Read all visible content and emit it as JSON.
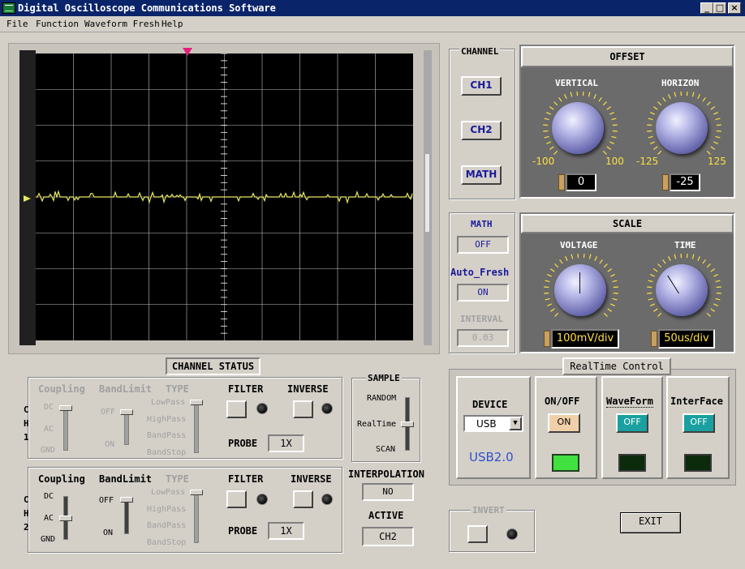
{
  "window": {
    "title": "Digital Oscilloscope Communications Software",
    "controls": [
      "_",
      "□",
      "×"
    ]
  },
  "menu": [
    "File",
    "Function",
    "Waveform Fresh",
    "Help"
  ],
  "channel": {
    "title": "CHANNEL",
    "buttons": [
      "CH1",
      "CH2",
      "MATH"
    ]
  },
  "offset": {
    "title": "OFFSET",
    "vertical": {
      "label": "VERTICAL",
      "min": "-100",
      "max": "100",
      "value": "0"
    },
    "horizon": {
      "label": "HORIZON",
      "min": "-125",
      "max": "125",
      "value": "-25"
    }
  },
  "math_panel": {
    "math_label": "MATH",
    "math_value": "OFF",
    "fresh_label": "Auto_Fresh",
    "fresh_value": "ON",
    "interval_label": "INTERVAL",
    "interval_value": "0.03"
  },
  "scale": {
    "title": "SCALE",
    "voltage": {
      "label": "VOLTAGE",
      "value": "100mV/div"
    },
    "time": {
      "label": "TIME",
      "value": "50us/div"
    }
  },
  "channel_status": {
    "title": "CHANNEL STATUS"
  },
  "ch1": {
    "side": [
      "C",
      "H",
      "1"
    ],
    "coupling": "Coupling",
    "bandlimit": "BandLimit",
    "type": "TYPE",
    "filter": "FILTER",
    "inverse": "INVERSE",
    "probe_label": "PROBE",
    "probe_value": "1X",
    "coupling_ticks": [
      "DC",
      "AC",
      "GND"
    ],
    "band_ticks": [
      "OFF",
      "ON"
    ],
    "type_ticks": [
      "LowPass",
      "HighPass",
      "BandPass",
      "BandStop"
    ]
  },
  "ch2": {
    "side": [
      "C",
      "H",
      "2"
    ],
    "coupling": "Coupling",
    "bandlimit": "BandLimit",
    "type": "TYPE",
    "filter": "FILTER",
    "inverse": "INVERSE",
    "probe_label": "PROBE",
    "probe_value": "1X",
    "coupling_ticks": [
      "DC",
      "AC",
      "GND"
    ],
    "band_ticks": [
      "OFF",
      "ON"
    ],
    "type_ticks": [
      "LowPass",
      "HighPass",
      "BandPass",
      "BandStop"
    ]
  },
  "sample": {
    "title": "SAMPLE",
    "ticks": [
      "RANDOM",
      "RealTime",
      "SCAN"
    ]
  },
  "interpolation": {
    "label": "INTERPOLATION",
    "value": "NO"
  },
  "active": {
    "label": "ACTIVE",
    "value": "CH2"
  },
  "realtime": {
    "title": "RealTime Control",
    "device_label": "DEVICE",
    "device_value": "USB",
    "device_info": "USB2.0",
    "onoff_label": "ON/OFF",
    "onoff_value": "ON",
    "waveform_label": "WaveForm",
    "waveform_value": "OFF",
    "interface_label": "InterFace",
    "interface_value": "OFF"
  },
  "invert": {
    "title": "INVERT"
  },
  "exit": "EXIT",
  "colors": {
    "trace": "#e8e860",
    "grid": "#ffffff",
    "screen": "#000000",
    "trigger_marker": "#e0207a",
    "toggle_on": "#f0d0a8",
    "toggle_off": "#1aa0a0",
    "led_on": "#40e040",
    "device_info": "#3050d0"
  }
}
